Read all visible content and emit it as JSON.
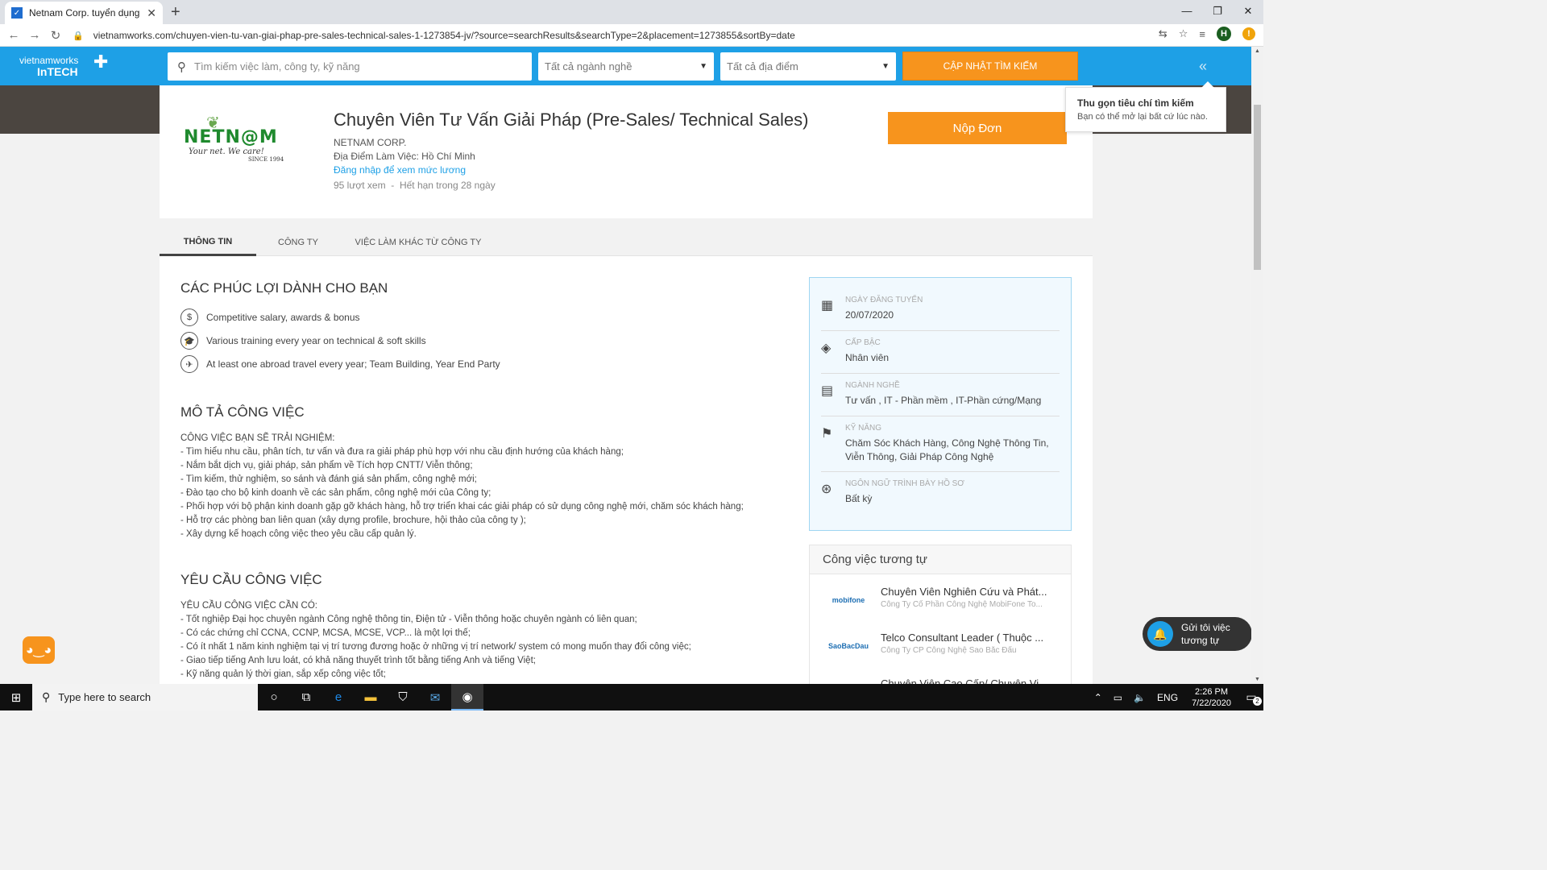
{
  "browser": {
    "tab_title": "Netnam Corp. tuyển dụng nhanh",
    "url": "vietnamworks.com/chuyen-vien-tu-van-giai-phap-pre-sales-technical-sales-1-1273854-jv/?source=searchResults&searchType=2&placement=1273855&sortBy=date",
    "profile_initial": "H"
  },
  "header": {
    "logo_line1": "vietnamworks",
    "logo_line2": "InTECH",
    "search_placeholder": "Tìm kiếm việc làm, công ty, kỹ năng",
    "industry_select": "Tất cả ngành nghề",
    "location_select": "Tất cả địa điểm",
    "update_button": "CẬP NHẬT TÌM KIẾM",
    "collapse_icon": "double-chevron-left"
  },
  "tooltip": {
    "title": "Thu gọn tiêu chí tìm kiếm",
    "body": "Bạn có thể mở lại bất cứ lúc nào."
  },
  "job": {
    "company_logo_text": "NETN@M",
    "company_logo_slogan": "Your net. We care!",
    "company_logo_since": "SINCE 1994",
    "title": "Chuyên Viên Tư Vấn Giải Pháp (Pre-Sales/ Technical Sales)",
    "company": "NETNAM CORP.",
    "location": "Địa Điểm Làm Việc: Hồ Chí Minh",
    "salary_link": "Đăng nhập để xem mức lương",
    "views": "95 lượt xem",
    "separator": "-",
    "expiry": "Hết hạn trong 28 ngày",
    "apply_button": "Nộp Đơn"
  },
  "tabs": [
    "THÔNG TIN",
    "CÔNG TY",
    "VIỆC LÀM KHÁC TỪ CÔNG TY"
  ],
  "benefits": {
    "heading": "CÁC PHÚC LỢI DÀNH CHO BẠN",
    "items": [
      {
        "icon": "dollar-icon",
        "text": "Competitive salary, awards & bonus"
      },
      {
        "icon": "graduation-cap-icon",
        "text": "Various training every year on technical & soft skills"
      },
      {
        "icon": "airplane-icon",
        "text": "At least one abroad travel every year; Team Building, Year End Party"
      }
    ]
  },
  "description": {
    "heading": "MÔ TẢ CÔNG VIỆC",
    "lines": [
      "CÔNG VIỆC BẠN SẼ TRẢI NGHIỆM:",
      "- Tìm hiểu nhu cầu, phân tích, tư vấn và đưa ra giải pháp phù hợp với nhu cầu định hướng của khách hàng;",
      "- Nắm bắt dịch vụ, giải pháp, sản phẩm về Tích hợp CNTT/ Viễn thông;",
      "- Tìm kiếm, thử nghiệm, so sánh và đánh giá sản phẩm, công nghệ mới;",
      "- Đào tạo cho bộ kinh doanh về các sản phẩm, công nghệ mới của Công ty;",
      "- Phối hợp với bộ phận kinh doanh gặp gỡ khách hàng, hỗ trợ triển khai các giải pháp có sử dụng công nghệ mới, chăm sóc khách hàng;",
      "- Hỗ trợ các phòng ban liên quan (xây dựng profile, brochure, hội thảo của công ty );",
      "- Xây dựng kế hoạch công việc theo yêu cầu cấp quản lý."
    ]
  },
  "requirements": {
    "heading": "YÊU CẦU CÔNG VIỆC",
    "lines": [
      "YÊU CẦU CÔNG VIỆC CẦN CÓ:",
      "- Tốt nghiệp Đại học chuyên ngành Công nghệ thông tin, Điện tử - Viễn thông hoặc chuyên ngành có liên quan;",
      "- Có các chứng chỉ CCNA, CCNP, MCSA, MCSE, VCP... là một lợi thế;",
      "- Có ít nhất 1 năm kinh nghiệm tại vị trí tương đương hoặc ở những vị trí network/ system có mong muốn thay đổi công việc;",
      "- Giao tiếp tiếng Anh lưu loát, có khả năng thuyết trình tốt bằng tiếng Anh và tiếng Việt;",
      "- Kỹ năng quản lý thời gian, sắp xếp công việc tốt;"
    ]
  },
  "info": [
    {
      "icon": "calendar-icon",
      "label": "NGÀY ĐĂNG TUYỂN",
      "value": "20/07/2020"
    },
    {
      "icon": "layers-icon",
      "label": "CẤP BẬC",
      "value": "Nhân viên"
    },
    {
      "icon": "briefcase-icon",
      "label": "NGÀNH NGHỀ",
      "value": "Tư vấn ,  IT - Phần mềm ,  IT-Phần cứng/Mạng"
    },
    {
      "icon": "flag-icon",
      "label": "KỸ NĂNG",
      "value": "Chăm Sóc Khách Hàng, Công Nghệ Thông Tin, Viễn Thông, Giải Pháp Công Nghệ"
    },
    {
      "icon": "language-icon",
      "label": "NGÔN NGỮ TRÌNH BÀY HỒ SƠ",
      "value": "Bất kỳ"
    }
  ],
  "similar": {
    "heading": "Công việc tương tự",
    "items": [
      {
        "logo": "mobifone",
        "title": "Chuyên Viên Nghiên Cứu và Phát...",
        "company": "Công Ty Cổ Phần Công Nghệ MobiFone To..."
      },
      {
        "logo": "SaoBacDau",
        "title": "Telco Consultant Leader ( Thuộc ...",
        "company": "Công Ty CP Công Nghệ Sao Bắc Đẩu"
      },
      {
        "logo": "",
        "title": "Chuyên Viên Cao Cấp/ Chuyên Vi...",
        "company": ""
      }
    ]
  },
  "notify": {
    "label_line1": "Gửi tôi việc",
    "label_line2": "tương tự"
  },
  "taskbar": {
    "search_placeholder": "Type here to search",
    "language": "ENG",
    "time": "2:26 PM",
    "date": "7/22/2020",
    "notification_count": "2"
  }
}
